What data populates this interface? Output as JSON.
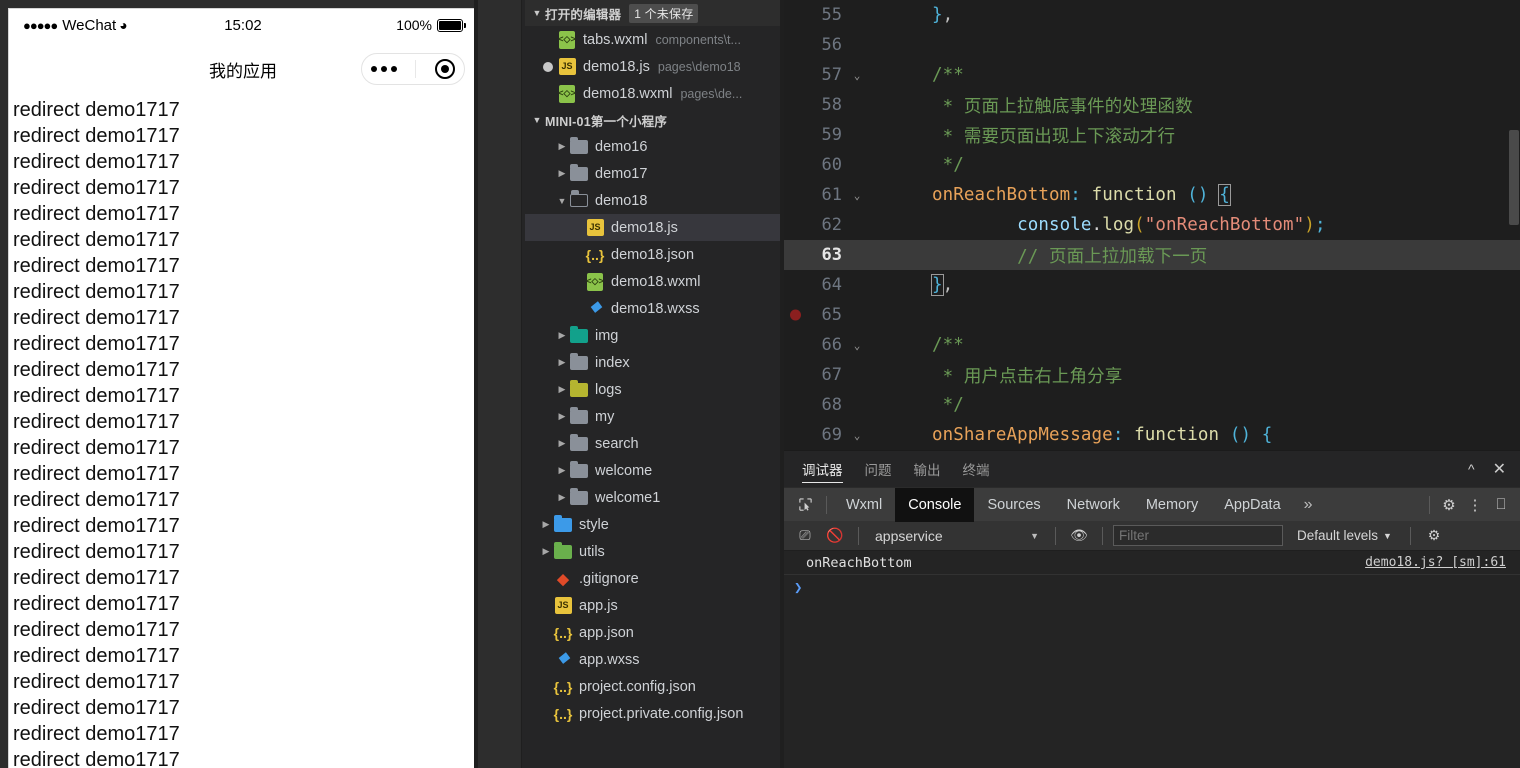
{
  "simulator": {
    "status_bar": {
      "signal_dots": "●●●●●",
      "carrier": "WeChat",
      "wifi_icon": "wifi-icon",
      "time": "15:02",
      "battery_percent": "100%"
    },
    "nav": {
      "title": "我的应用",
      "capsule_more_icon": "more-dots-icon",
      "capsule_target_icon": "target-icon"
    },
    "page": {
      "row_text": "redirect demo1717",
      "row_count": 26
    }
  },
  "explorer": {
    "open_editors": {
      "title": "打开的编辑器",
      "badge": "1 个未保存",
      "items": [
        {
          "name": "tabs.wxml",
          "path": "components\\t...",
          "icon": "wxml-file-icon",
          "unsaved": false
        },
        {
          "name": "demo18.js",
          "path": "pages\\demo18",
          "icon": "js-file-icon",
          "unsaved": true
        },
        {
          "name": "demo18.wxml",
          "path": "pages\\de...",
          "icon": "wxml-file-icon",
          "unsaved": false
        }
      ]
    },
    "project": {
      "title": "MINI-01第一个小程序",
      "tree": [
        {
          "label": "demo16",
          "type": "folder",
          "expanded": false,
          "depth": 1
        },
        {
          "label": "demo17",
          "type": "folder",
          "expanded": false,
          "depth": 1
        },
        {
          "label": "demo18",
          "type": "folder",
          "expanded": true,
          "depth": 1
        },
        {
          "label": "demo18.js",
          "type": "js",
          "depth": 2,
          "selected": true
        },
        {
          "label": "demo18.json",
          "type": "json",
          "depth": 2
        },
        {
          "label": "demo18.wxml",
          "type": "wxml",
          "depth": 2
        },
        {
          "label": "demo18.wxss",
          "type": "wxss",
          "depth": 2
        },
        {
          "label": "img",
          "type": "folder-img",
          "expanded": false,
          "depth": 1
        },
        {
          "label": "index",
          "type": "folder",
          "expanded": false,
          "depth": 1
        },
        {
          "label": "logs",
          "type": "folder-logs",
          "expanded": false,
          "depth": 1
        },
        {
          "label": "my",
          "type": "folder",
          "expanded": false,
          "depth": 1
        },
        {
          "label": "search",
          "type": "folder",
          "expanded": false,
          "depth": 1
        },
        {
          "label": "welcome",
          "type": "folder",
          "expanded": false,
          "depth": 1
        },
        {
          "label": "welcome1",
          "type": "folder",
          "expanded": false,
          "depth": 1
        },
        {
          "label": "style",
          "type": "folder-style",
          "expanded": false,
          "depth": 0
        },
        {
          "label": "utils",
          "type": "folder-utils",
          "expanded": false,
          "depth": 0
        },
        {
          "label": ".gitignore",
          "type": "git",
          "depth": 0
        },
        {
          "label": "app.js",
          "type": "js",
          "depth": 0
        },
        {
          "label": "app.json",
          "type": "json",
          "depth": 0
        },
        {
          "label": "app.wxss",
          "type": "wxss",
          "depth": 0
        },
        {
          "label": "project.config.json",
          "type": "json",
          "depth": 0
        },
        {
          "label": "project.private.config.json",
          "type": "json",
          "depth": 0
        }
      ]
    }
  },
  "editor": {
    "lines": [
      {
        "num": "55",
        "fold": "",
        "breakpoint": false,
        "active": false
      },
      {
        "num": "56",
        "fold": "",
        "breakpoint": false,
        "active": false
      },
      {
        "num": "57",
        "fold": "⌄",
        "breakpoint": false,
        "active": false
      },
      {
        "num": "58",
        "fold": "",
        "breakpoint": false,
        "active": false
      },
      {
        "num": "59",
        "fold": "",
        "breakpoint": false,
        "active": false
      },
      {
        "num": "60",
        "fold": "",
        "breakpoint": false,
        "active": false
      },
      {
        "num": "61",
        "fold": "⌄",
        "breakpoint": false,
        "active": false
      },
      {
        "num": "62",
        "fold": "",
        "breakpoint": false,
        "active": false
      },
      {
        "num": "63",
        "fold": "",
        "breakpoint": false,
        "active": true
      },
      {
        "num": "64",
        "fold": "",
        "breakpoint": false,
        "active": false
      },
      {
        "num": "65",
        "fold": "",
        "breakpoint": true,
        "active": false
      },
      {
        "num": "66",
        "fold": "⌄",
        "breakpoint": false,
        "active": false
      },
      {
        "num": "67",
        "fold": "",
        "breakpoint": false,
        "active": false
      },
      {
        "num": "68",
        "fold": "",
        "breakpoint": false,
        "active": false
      },
      {
        "num": "69",
        "fold": "⌄",
        "breakpoint": false,
        "active": false
      }
    ],
    "code": {
      "l55": "},",
      "l56": "",
      "l57": "/**",
      "l58": " * 页面上拉触底事件的处理函数",
      "l59": " * 需要页面出现上下滚动才行",
      "l60": " */",
      "l61_name": "onReachBottom",
      "l61_colon": ":",
      "l61_fn": "function",
      "l61_paren": "()",
      "l61_brace": "{",
      "l62_obj": "console",
      "l62_dot": ".",
      "l62_method": "log",
      "l62_open": "(",
      "l62_str": "\"onReachBottom\"",
      "l62_close": ")",
      "l62_semi": ";",
      "l63": "// 页面上拉加载下一页",
      "l64_brace": "}",
      "l64_comma": ",",
      "l65": "",
      "l66": "/**",
      "l67": " * 用户点击右上角分享",
      "l68": " */",
      "l69_name": "onShareAppMessage",
      "l69_colon": ":",
      "l69_fn": "function",
      "l69_paren": "()",
      "l69_brace": "{"
    }
  },
  "devtools": {
    "panel_tabs": [
      {
        "label": "调试器",
        "active": true
      },
      {
        "label": "问题",
        "active": false
      },
      {
        "label": "输出",
        "active": false
      },
      {
        "label": "终端",
        "active": false
      }
    ],
    "panel_actions": {
      "collapse_icon": "chevron-up-icon",
      "close_icon": "close-icon"
    },
    "sub_tabs": [
      {
        "label": "Wxml",
        "active": false
      },
      {
        "label": "Console",
        "active": true
      },
      {
        "label": "Sources",
        "active": false
      },
      {
        "label": "Network",
        "active": false
      },
      {
        "label": "Memory",
        "active": false
      },
      {
        "label": "AppData",
        "active": false
      }
    ],
    "sub_more": "»",
    "inspect_icon": "inspect-element-icon",
    "settings_icon": "gear-icon",
    "kebab_icon": "more-vertical-icon",
    "dock_icon": "dock-panel-icon",
    "filter_bar": {
      "sidebar_icon": "console-sidebar-icon",
      "clear_icon": "clear-console-icon",
      "context": "appservice",
      "eye_icon": "live-expression-icon",
      "filter_placeholder": "Filter",
      "filter_value": "",
      "levels": "Default levels",
      "settings_icon": "gear-icon"
    },
    "console": {
      "messages": [
        {
          "text": "onReachBottom",
          "source": "demo18.js? [sm]:61"
        }
      ],
      "prompt": "❯"
    }
  }
}
